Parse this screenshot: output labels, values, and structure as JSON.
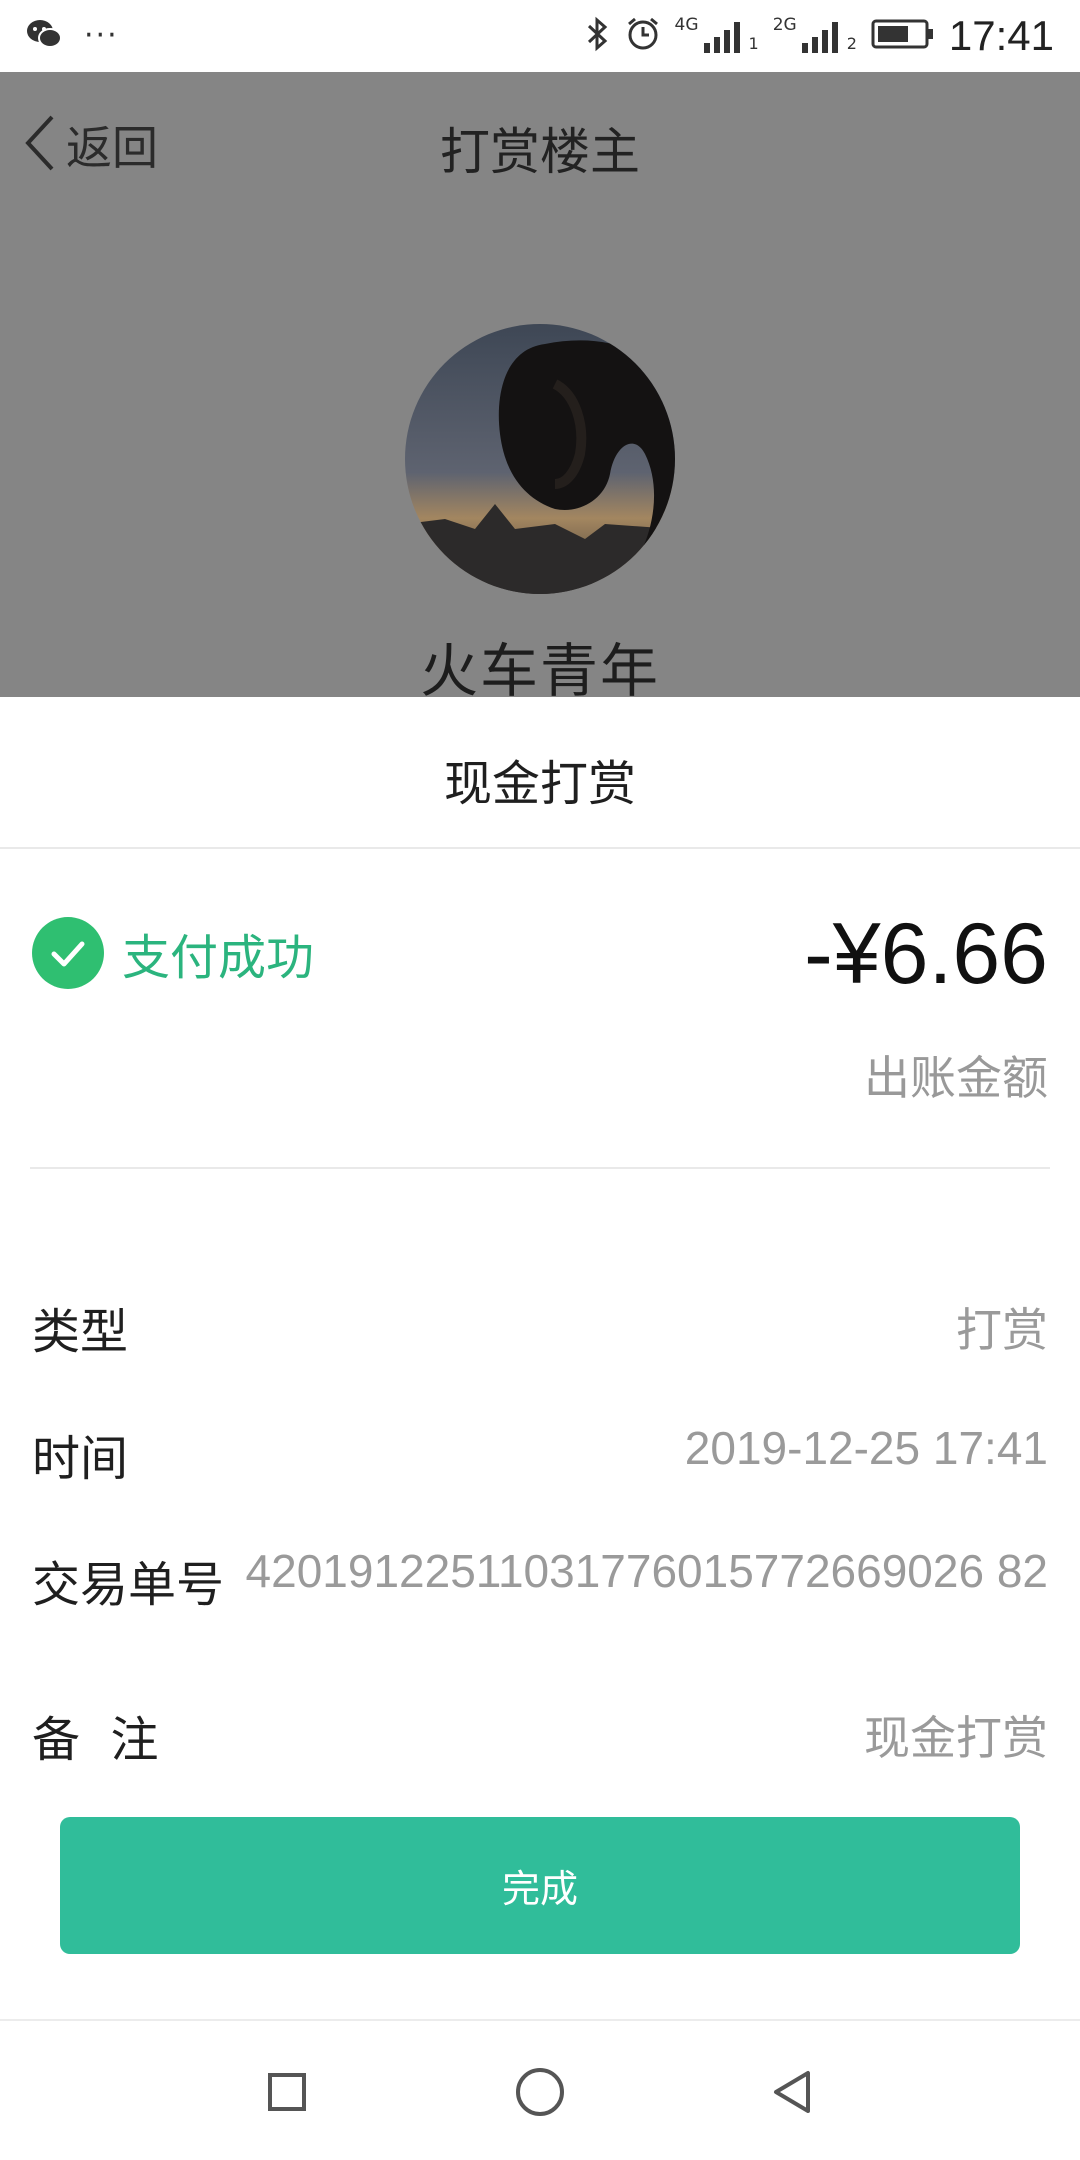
{
  "status_bar": {
    "time": "17:41",
    "left_icons": [
      "wechat-icon",
      "more-dots-icon"
    ],
    "more": "···",
    "network_1": "4G",
    "network_2": "2G",
    "sim_1": "1",
    "sim_2": "2",
    "right_icons": [
      "bluetooth-icon",
      "alarm-icon",
      "signal-4g-icon",
      "signal-2g-icon",
      "battery-icon"
    ]
  },
  "header": {
    "back_label": "返回",
    "title": "打赏楼主"
  },
  "profile": {
    "name": "火车青年"
  },
  "sheet": {
    "title": "现金打赏",
    "status": "支付成功",
    "amount": "-¥6.66",
    "amount_label": "出账金额",
    "rows": [
      {
        "label": "类型",
        "value": "打赏"
      },
      {
        "label": "时间",
        "value": "2019-12-25 17:41"
      },
      {
        "label": "交易单号",
        "value": "42019122511031776015772669026 82"
      },
      {
        "label": "备  注",
        "value": "现金打赏"
      }
    ],
    "done_label": "完成"
  },
  "colors": {
    "overlay": "#858585",
    "success_green": "#2fbf71",
    "status_text": "#2bb47e",
    "button": "#30bd9a"
  },
  "navbar": {
    "icons": [
      "recents-square-icon",
      "home-circle-icon",
      "back-triangle-icon"
    ]
  }
}
